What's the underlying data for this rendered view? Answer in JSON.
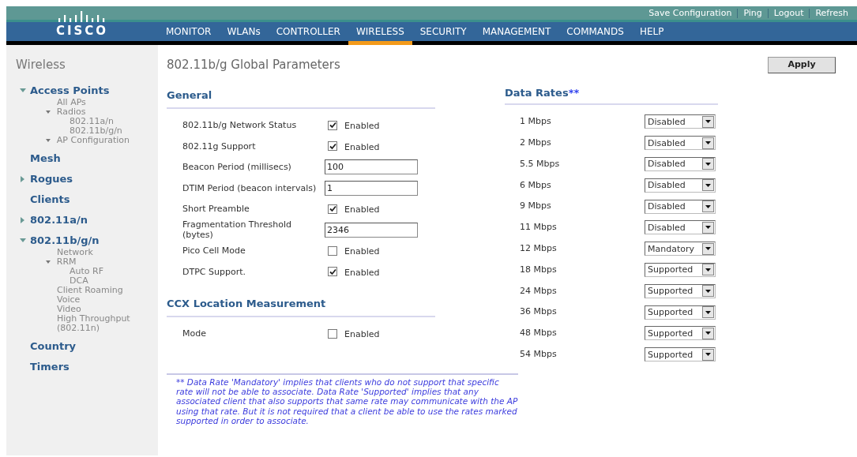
{
  "header": {
    "logo_text": "CISCO",
    "top_links": [
      "Save Configuration",
      "Ping",
      "Logout",
      "Refresh"
    ],
    "menu": [
      {
        "label": "MONITOR",
        "selected": false
      },
      {
        "label": "WLANs",
        "selected": false
      },
      {
        "label": "CONTROLLER",
        "selected": false
      },
      {
        "label": "WIRELESS",
        "selected": true
      },
      {
        "label": "SECURITY",
        "selected": false
      },
      {
        "label": "MANAGEMENT",
        "selected": false
      },
      {
        "label": "COMMANDS",
        "selected": false
      },
      {
        "label": "HELP",
        "selected": false
      }
    ]
  },
  "sidebar": {
    "title": "Wireless",
    "items": [
      {
        "label": "Access Points",
        "expanded": true,
        "children": [
          {
            "label": "All APs"
          },
          {
            "label": "Radios",
            "expanded": true,
            "children": [
              {
                "label": "802.11a/n"
              },
              {
                "label": "802.11b/g/n"
              }
            ]
          },
          {
            "label": "AP Configuration",
            "expanded": true
          }
        ]
      },
      {
        "label": "Mesh"
      },
      {
        "label": "Rogues",
        "expanded": false
      },
      {
        "label": "Clients"
      },
      {
        "label": "802.11a/n",
        "expanded": false
      },
      {
        "label": "802.11b/g/n",
        "expanded": true,
        "children": [
          {
            "label": "Network"
          },
          {
            "label": "RRM",
            "expanded": true,
            "children": [
              {
                "label": "Auto RF"
              },
              {
                "label": "DCA"
              }
            ]
          },
          {
            "label": "Client Roaming"
          },
          {
            "label": "Voice"
          },
          {
            "label": "Video"
          },
          {
            "label": "High Throughput (802.11n)"
          }
        ]
      },
      {
        "label": "Country"
      },
      {
        "label": "Timers"
      }
    ]
  },
  "page": {
    "title": "802.11b/g Global Parameters",
    "apply_button": "Apply"
  },
  "general": {
    "title": "General",
    "rows": [
      {
        "kind": "checkbox",
        "label": "802.11b/g Network Status",
        "checked": true,
        "option": "Enabled"
      },
      {
        "kind": "checkbox",
        "label": "802.11g Support",
        "checked": true,
        "option": "Enabled"
      },
      {
        "kind": "text",
        "label": "Beacon Period (millisecs)",
        "value": "100"
      },
      {
        "kind": "text",
        "label": "DTIM Period (beacon intervals)",
        "value": "1"
      },
      {
        "kind": "checkbox",
        "label": "Short Preamble",
        "checked": true,
        "option": "Enabled"
      },
      {
        "kind": "text",
        "label": "Fragmentation Threshold (bytes)",
        "value": "2346"
      },
      {
        "kind": "checkbox",
        "label": "Pico Cell Mode",
        "checked": false,
        "option": "Enabled"
      },
      {
        "kind": "checkbox",
        "label": "DTPC Support.",
        "checked": true,
        "option": "Enabled"
      }
    ]
  },
  "ccx": {
    "title": "CCX Location Measurement",
    "rows": [
      {
        "kind": "checkbox",
        "label": "Mode",
        "checked": false,
        "option": "Enabled"
      }
    ]
  },
  "data_rates": {
    "title": "Data Rates",
    "marker": "**",
    "rows": [
      {
        "label": "1 Mbps",
        "value": "Disabled"
      },
      {
        "label": "2 Mbps",
        "value": "Disabled"
      },
      {
        "label": "5.5 Mbps",
        "value": "Disabled"
      },
      {
        "label": "6 Mbps",
        "value": "Disabled"
      },
      {
        "label": "9 Mbps",
        "value": "Disabled"
      },
      {
        "label": "11 Mbps",
        "value": "Disabled"
      },
      {
        "label": "12 Mbps",
        "value": "Mandatory"
      },
      {
        "label": "18 Mbps",
        "value": "Supported"
      },
      {
        "label": "24 Mbps",
        "value": "Supported"
      },
      {
        "label": "36 Mbps",
        "value": "Supported"
      },
      {
        "label": "48 Mbps",
        "value": "Supported"
      },
      {
        "label": "54 Mbps",
        "value": "Supported"
      }
    ]
  },
  "footnote": "** Data Rate 'Mandatory' implies that clients who do not support that specific rate will not be able to associate. Data Rate 'Supported' implies that any associated client that also supports that same rate may communicate with the AP using that rate. But it is not required that a client be able to use the rates marked supported in order to associate."
}
